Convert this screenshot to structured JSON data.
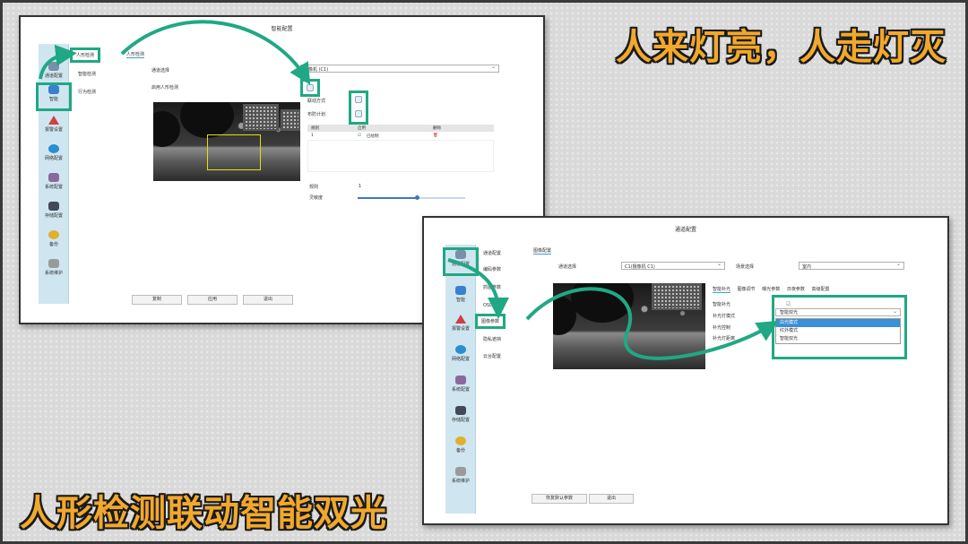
{
  "headlines": {
    "top": "人来灯亮，人走灯灭",
    "bottom": "人形检测联动智能双光"
  },
  "accent_color": "#20a884",
  "headline_color": "#f2a82c",
  "win1": {
    "title": "智能配置",
    "sidebar": [
      {
        "label": "通道配置",
        "icon": "camera-icon"
      },
      {
        "label": "智能",
        "icon": "smart-icon"
      },
      {
        "label": "报警设置",
        "icon": "alarm-icon"
      },
      {
        "label": "网络配置",
        "icon": "network-icon"
      },
      {
        "label": "系统配置",
        "icon": "settings-icon"
      },
      {
        "label": "存储配置",
        "icon": "storage-icon"
      },
      {
        "label": "备份",
        "icon": "backup-icon"
      },
      {
        "label": "系统维护",
        "icon": "maintenance-icon"
      }
    ],
    "subnav": [
      "人形检测",
      "智能检测",
      "行为检测"
    ],
    "breadcrumb": "人形检测",
    "channel_label": "通道选择",
    "channel_value": "摄像机 (C1)",
    "enable_label": "启用人形检测",
    "link_label": "联动方式",
    "schedule_label": "布防计划",
    "table": {
      "headers": [
        "规则",
        "启用",
        "删除"
      ],
      "rows": [
        {
          "rule": "1",
          "state": "已绘制"
        }
      ]
    },
    "rule_label": "规则",
    "rule_value": "1",
    "sensitivity_label": "灵敏度",
    "sensitivity_value": 0.55,
    "buttons": [
      "复制",
      "应用",
      "退出"
    ]
  },
  "win2": {
    "title": "通道配置",
    "sidebar": [
      {
        "label": "通道配置",
        "icon": "camera-icon"
      },
      {
        "label": "智能",
        "icon": "smart-icon"
      },
      {
        "label": "报警设置",
        "icon": "alarm-icon"
      },
      {
        "label": "网络配置",
        "icon": "network-icon"
      },
      {
        "label": "系统配置",
        "icon": "settings-icon"
      },
      {
        "label": "存储配置",
        "icon": "storage-icon"
      },
      {
        "label": "备份",
        "icon": "backup-icon"
      },
      {
        "label": "系统维护",
        "icon": "maintenance-icon"
      }
    ],
    "subnav": [
      "通道配置",
      "编码参数",
      "抓图参数",
      "OSD配置",
      "图像参数",
      "隐私遮挡",
      "云台配置"
    ],
    "breadcrumb": "图像配置",
    "channel_label": "通道选择",
    "channel_value": "C1(摄像机 C1)",
    "scene_label": "场景选择",
    "scene_value": "室内",
    "tabs": [
      "智能补光",
      "图像调节",
      "曝光参数",
      "日夜参数",
      "高级配置"
    ],
    "fill_light_label": "智能补光",
    "fill_mode_label": "补光灯模式",
    "fill_control_label": "补光控制",
    "fill_distance_label": "补光灯距离",
    "dropdown": {
      "current": "智能双光",
      "options": [
        "白光模式",
        "红外模式",
        "智能双光"
      ],
      "selected_index": 0
    },
    "buttons": [
      "恢复默认参数",
      "退出"
    ]
  }
}
